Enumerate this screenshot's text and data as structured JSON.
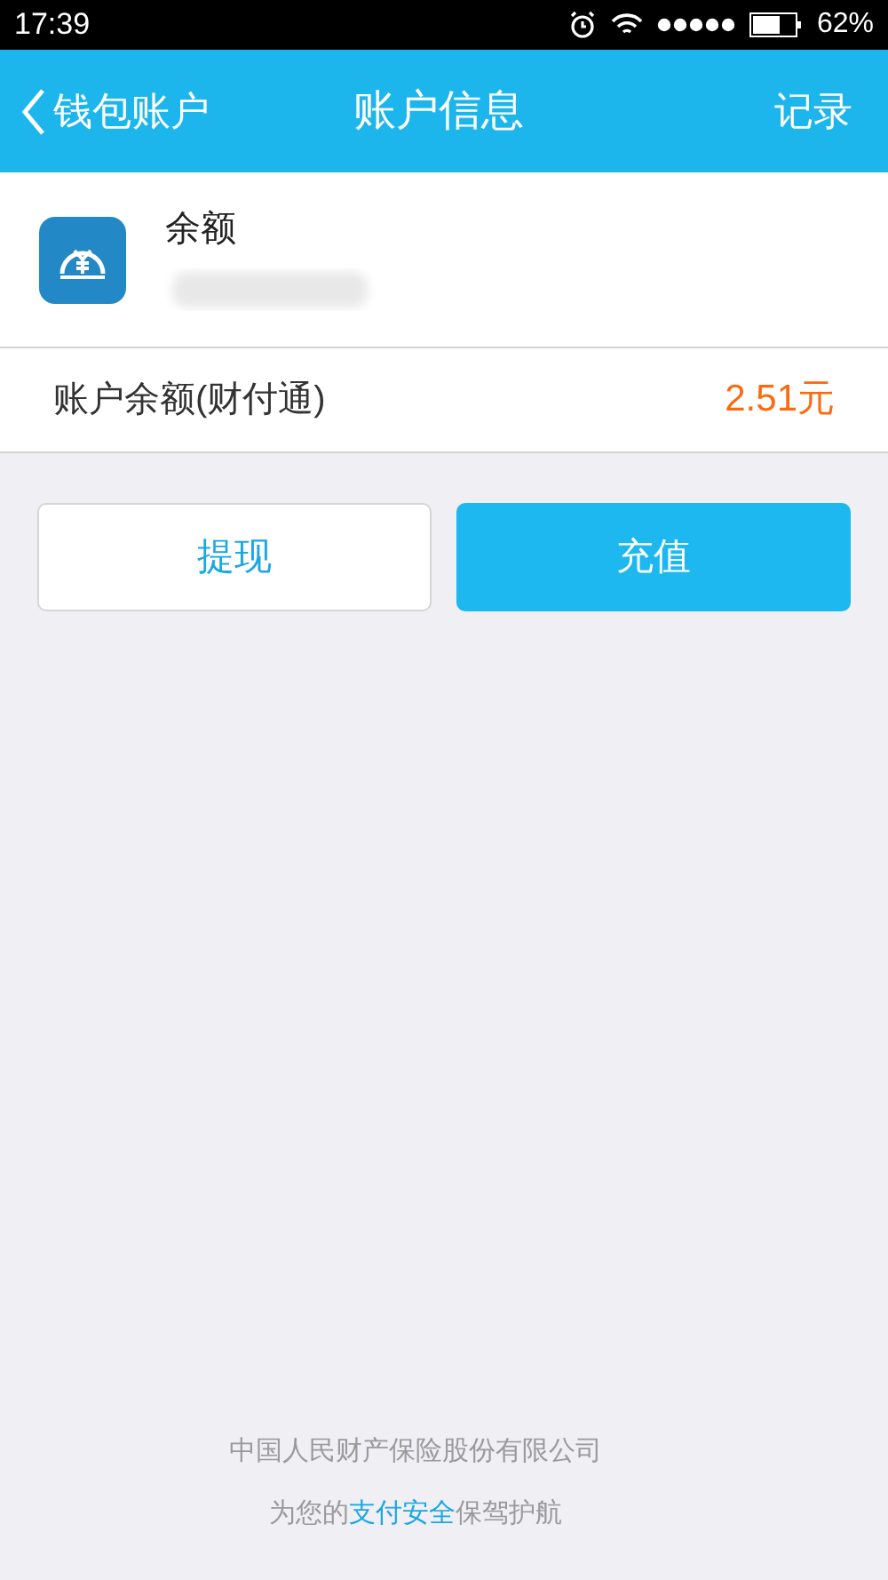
{
  "status_bar": {
    "time": "17:39",
    "battery": "62%"
  },
  "nav": {
    "back": "钱包账户",
    "title": "账户信息",
    "action": "记录"
  },
  "account": {
    "name": "余额"
  },
  "balance": {
    "label": "账户余额(财付通)",
    "amount": "2.51元"
  },
  "buttons": [
    {
      "label": "提现",
      "kind": "secondary"
    },
    {
      "label": "充值",
      "kind": "primary"
    }
  ],
  "footer": {
    "company": "中国人民财产保险股份有限公司",
    "slogan_before": "为您的",
    "slogan_link": "支付安全",
    "slogan_after": "保驾护航"
  }
}
